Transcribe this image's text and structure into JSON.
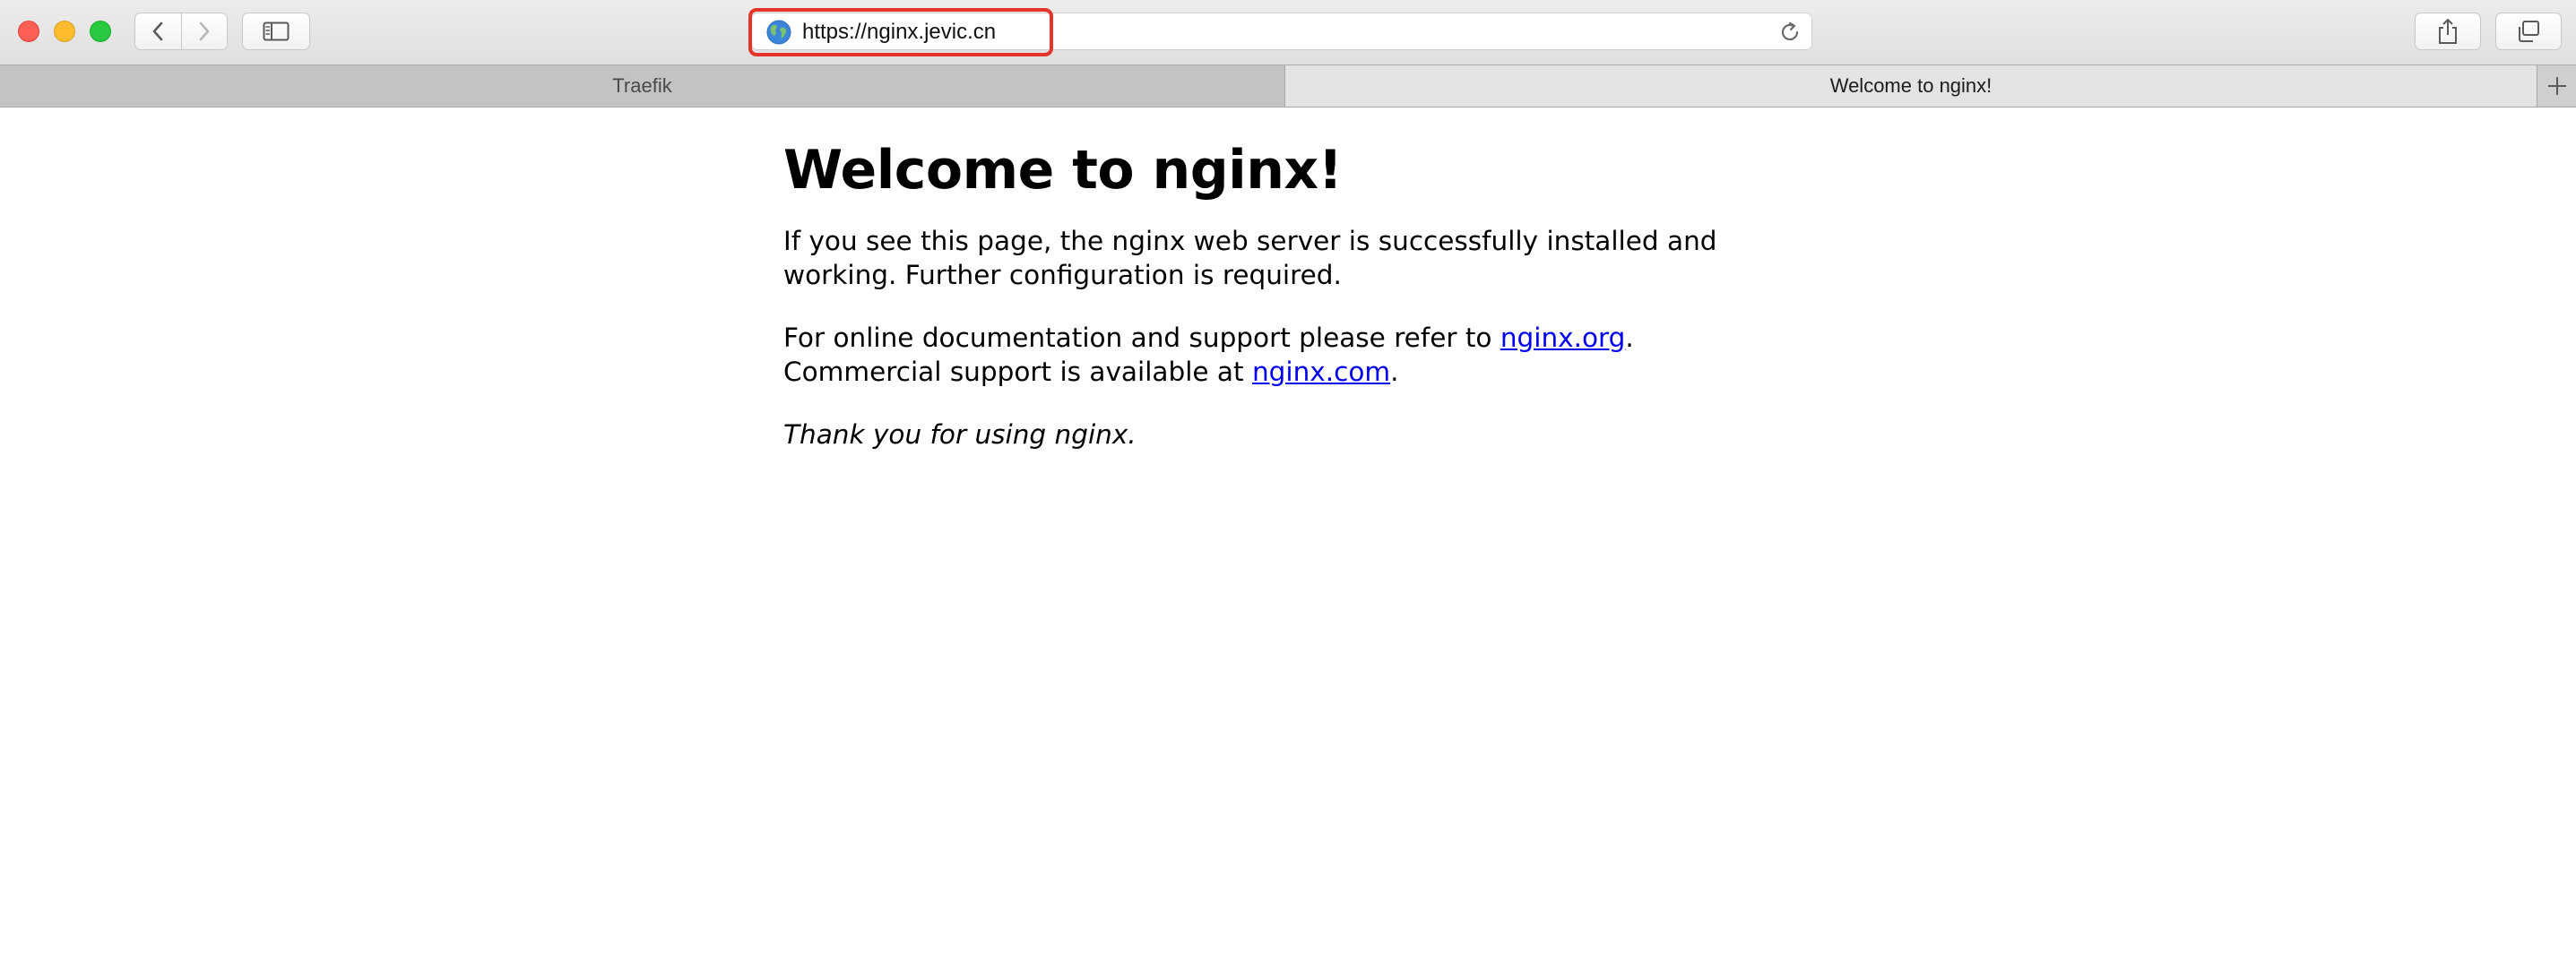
{
  "browser": {
    "url": "https://nginx.jevic.cn",
    "tabs": [
      {
        "label": "Traefik",
        "active": false
      },
      {
        "label": "Welcome to nginx!",
        "active": true
      }
    ],
    "icons": {
      "back": "chevron-left-icon",
      "forward": "chevron-right-icon",
      "sidebar": "sidebar-icon",
      "site": "globe-icon",
      "reload": "reload-icon",
      "share": "share-icon",
      "tabs_overview": "tabs-overview-icon",
      "new_tab": "plus-icon"
    },
    "colors": {
      "highlight": "#e5352b",
      "close": "#fe5f57",
      "minimize": "#febc2e",
      "maximize": "#28c840",
      "link": "#0000ee"
    }
  },
  "page": {
    "title": "Welcome to nginx!",
    "p1": "If you see this page, the nginx web server is successfully installed and working. Further configuration is required.",
    "p2_text1": "For online documentation and support please refer to ",
    "p2_link1": "nginx.org",
    "p2_text2": ".",
    "p2_text3": "Commercial support is available at ",
    "p2_link2": "nginx.com",
    "p2_text4": ".",
    "p3": "Thank you for using nginx."
  }
}
